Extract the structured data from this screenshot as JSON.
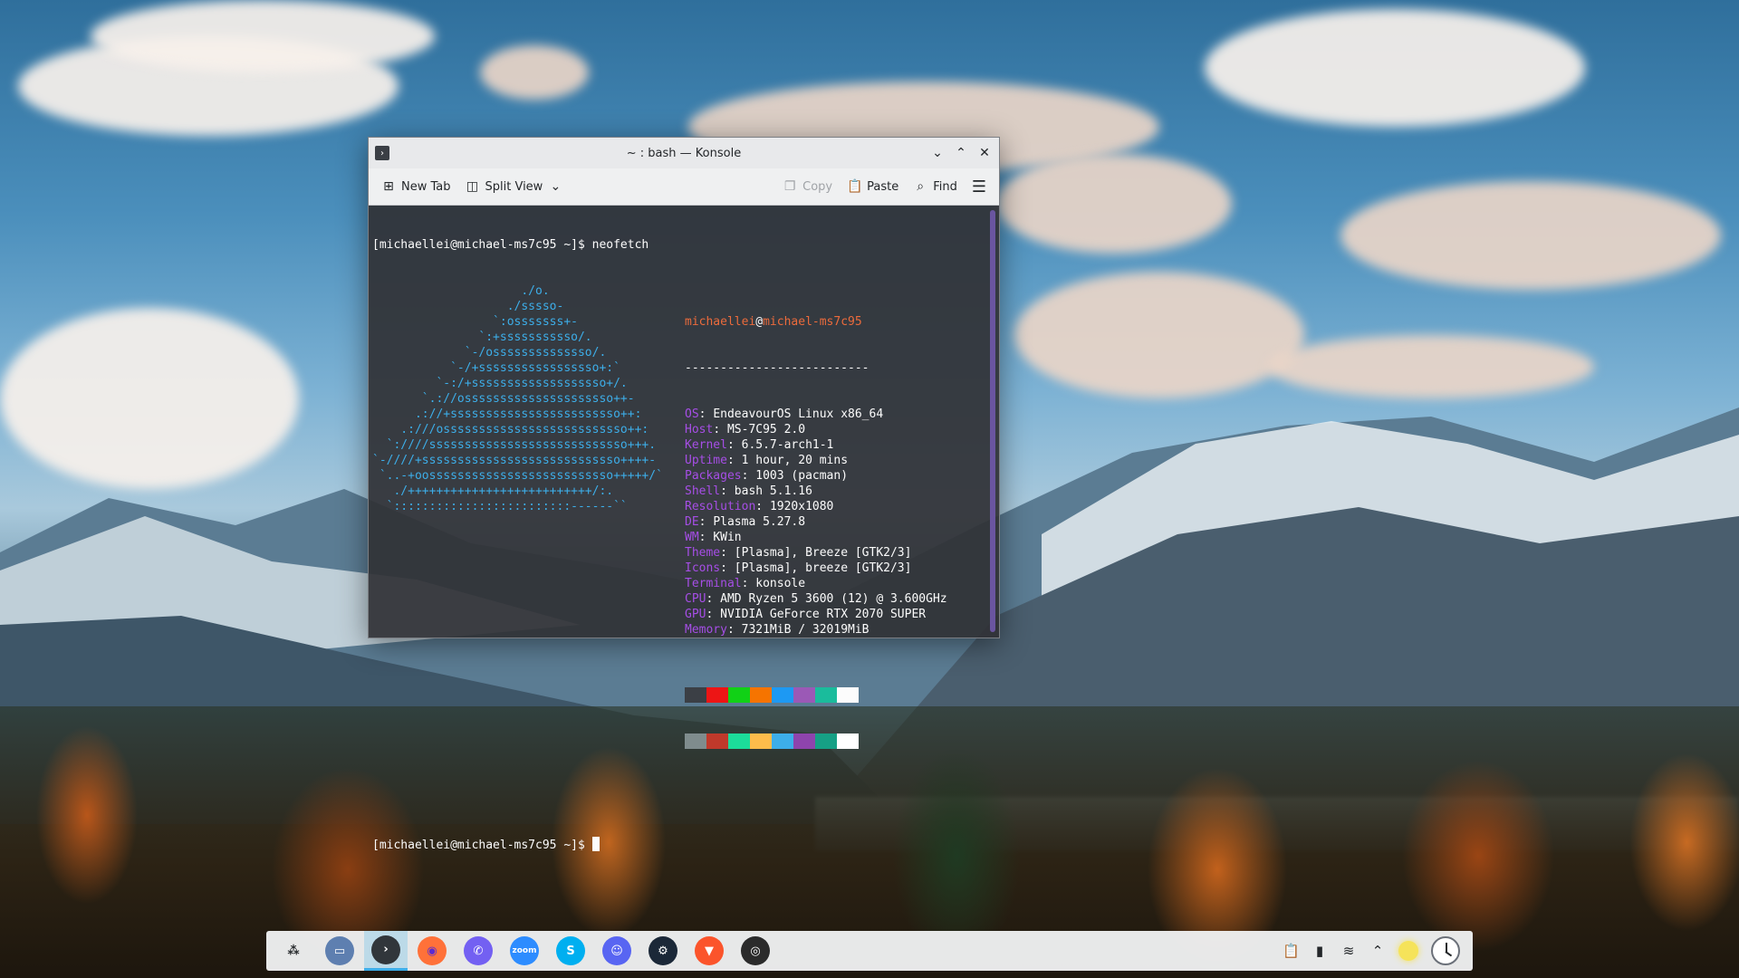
{
  "window": {
    "title": "~ : bash — Konsole",
    "controls": {
      "minimize": "⌄",
      "maximize": "⌃",
      "close": "✕"
    }
  },
  "toolbar": {
    "new_tab": "New Tab",
    "split_view": "Split View",
    "copy": "Copy",
    "paste": "Paste",
    "find": "Find"
  },
  "terminal": {
    "prompt_command": "[michaellei@michael-ms7c95 ~]$ neofetch",
    "prompt_final": "[michaellei@michael-ms7c95 ~]$ ",
    "logo_lines": [
      "                     ./o.",
      "                   ./sssso-",
      "                 `:osssssss+-",
      "               `:+sssssssssso/.",
      "             `-/ossssssssssssso/.",
      "           `-/+sssssssssssssssso+:`",
      "         `-:/+sssssssssssssssssso+/.",
      "       `.://osssssssssssssssssssso++-",
      "      .://+ssssssssssssssssssssssso++:",
      "    .:///ossssssssssssssssssssssssso++:",
      "  `:////ssssssssssssssssssssssssssso+++.",
      "`-////+ssssssssssssssssssssssssssso++++-",
      " `..-+oossssssssssssssssssssssssso+++++/`",
      "   ./++++++++++++++++++++++++++/:.",
      "  `:::::::::::::::::::::::::------``"
    ],
    "user": "michaellei",
    "host": "michael-ms7c95",
    "separator": "--------------------------",
    "info": [
      {
        "key": "OS",
        "value": "EndeavourOS Linux x86_64"
      },
      {
        "key": "Host",
        "value": "MS-7C95 2.0"
      },
      {
        "key": "Kernel",
        "value": "6.5.7-arch1-1"
      },
      {
        "key": "Uptime",
        "value": "1 hour, 20 mins"
      },
      {
        "key": "Packages",
        "value": "1003 (pacman)"
      },
      {
        "key": "Shell",
        "value": "bash 5.1.16"
      },
      {
        "key": "Resolution",
        "value": "1920x1080"
      },
      {
        "key": "DE",
        "value": "Plasma 5.27.8"
      },
      {
        "key": "WM",
        "value": "KWin"
      },
      {
        "key": "Theme",
        "value": "[Plasma], Breeze [GTK2/3]"
      },
      {
        "key": "Icons",
        "value": "[Plasma], breeze [GTK2/3]"
      },
      {
        "key": "Terminal",
        "value": "konsole"
      },
      {
        "key": "CPU",
        "value": "AMD Ryzen 5 3600 (12) @ 3.600GHz"
      },
      {
        "key": "GPU",
        "value": "NVIDIA GeForce RTX 2070 SUPER"
      },
      {
        "key": "Memory",
        "value": "7321MiB / 32019MiB"
      }
    ],
    "palette_dark": [
      "#3b3f45",
      "#ed1515",
      "#11d116",
      "#f67400",
      "#1d99f3",
      "#9b59b6",
      "#1abc9c",
      "#fcfcfc"
    ],
    "palette_bright": [
      "#7f8c8d",
      "#c0392b",
      "#1cdc9a",
      "#fdbc4b",
      "#3daee9",
      "#8e44ad",
      "#16a085",
      "#ffffff"
    ]
  },
  "taskbar": {
    "apps": [
      {
        "name": "application-launcher-icon",
        "glyph": "⁂",
        "bg": "transparent",
        "fg": "#232629"
      },
      {
        "name": "dolphin-icon",
        "glyph": "▭",
        "bg": "#5e7fb0",
        "fg": "#ffffff"
      },
      {
        "name": "konsole-icon",
        "glyph": "›",
        "bg": "#31363b",
        "fg": "#ffffff"
      },
      {
        "name": "firefox-icon",
        "glyph": "◉",
        "bg": "#ff7139",
        "fg": "#5b2ad1"
      },
      {
        "name": "viber-icon",
        "glyph": "✆",
        "bg": "#7360f2",
        "fg": "#ffffff"
      },
      {
        "name": "zoom-icon",
        "glyph": "zoom",
        "bg": "#2d8cff",
        "fg": "#ffffff"
      },
      {
        "name": "skype-icon",
        "glyph": "S",
        "bg": "#00aff0",
        "fg": "#ffffff"
      },
      {
        "name": "discord-icon",
        "glyph": "☺",
        "bg": "#5865f2",
        "fg": "#ffffff"
      },
      {
        "name": "steam-icon",
        "glyph": "⚙",
        "bg": "#1b2838",
        "fg": "#ffffff"
      },
      {
        "name": "brave-icon",
        "glyph": "▼",
        "bg": "#fb542b",
        "fg": "#ffffff"
      },
      {
        "name": "spiral-app-icon",
        "glyph": "◎",
        "bg": "#2b2b2b",
        "fg": "#ffffff"
      }
    ],
    "active_app": "konsole-icon"
  }
}
